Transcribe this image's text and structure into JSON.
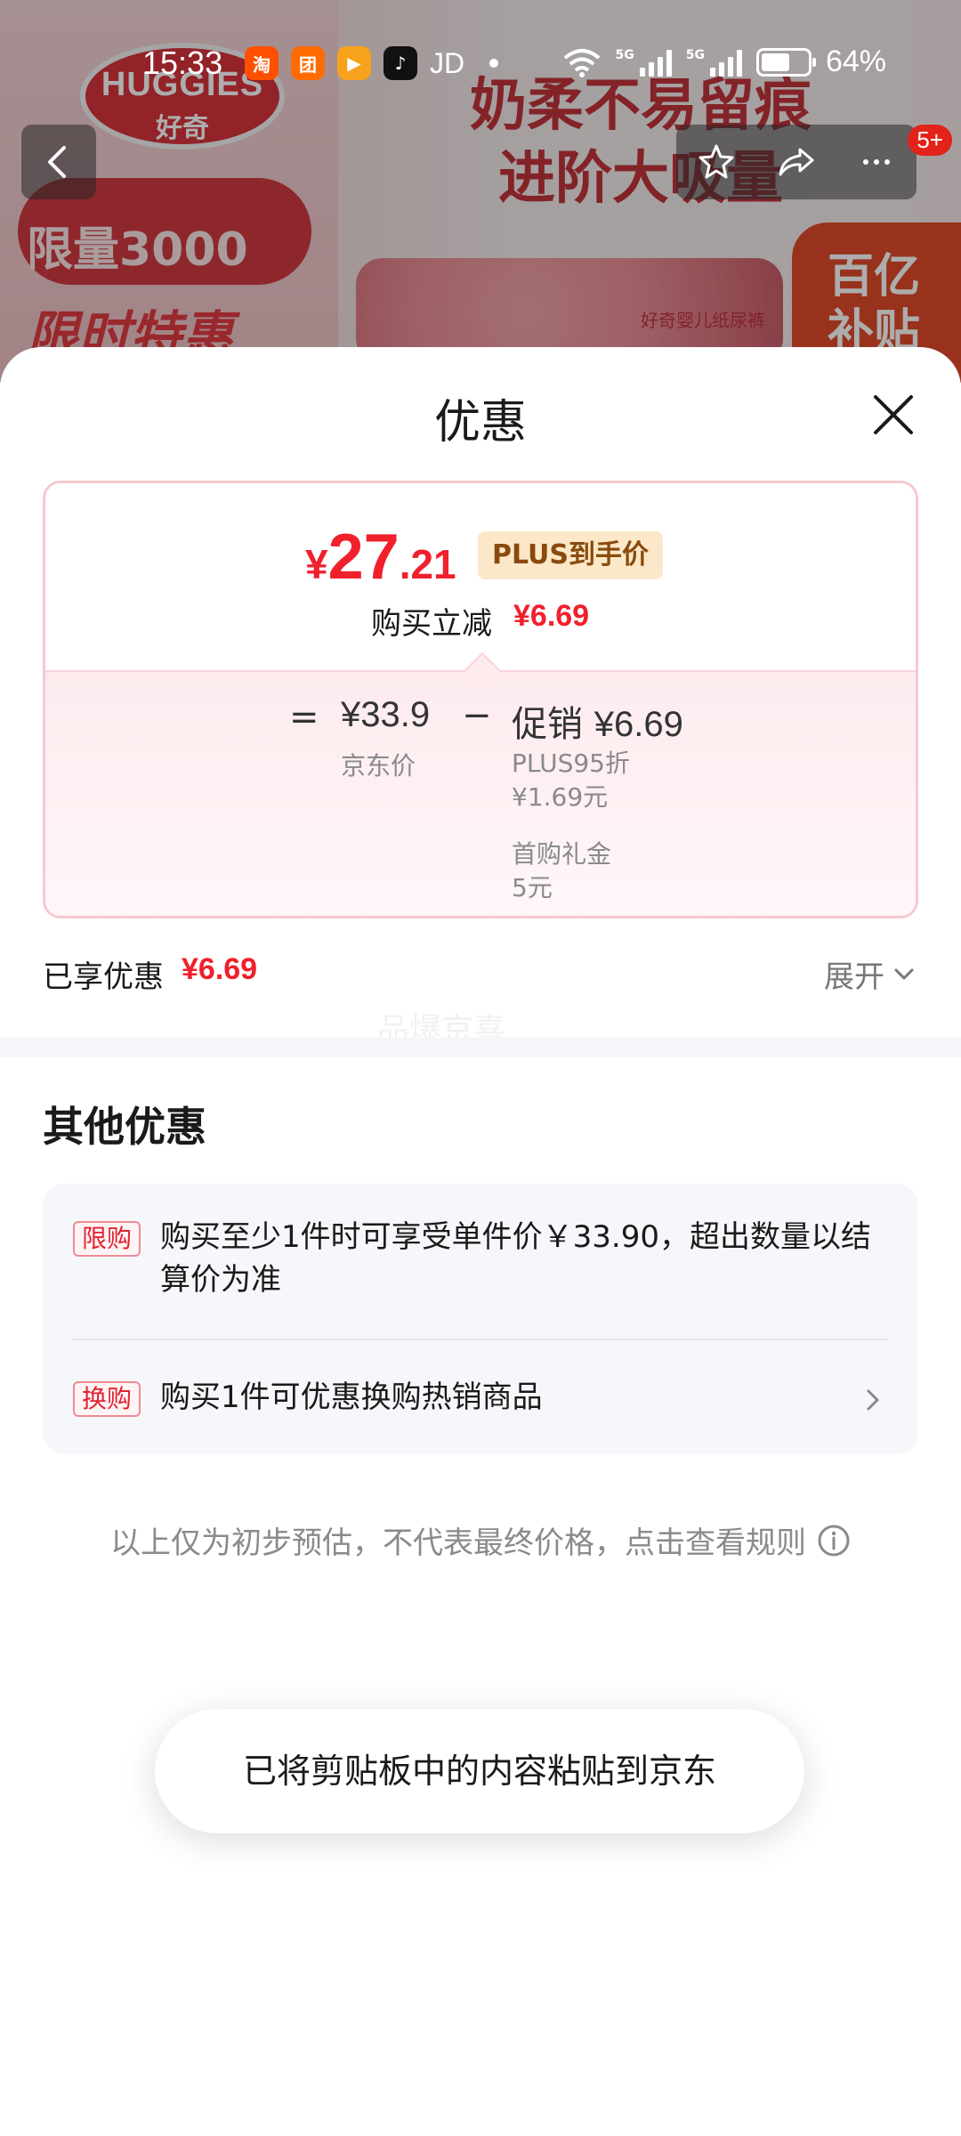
{
  "status_bar": {
    "time": "15:33",
    "app_icons": [
      {
        "name": "taobao-icon",
        "glyph": "淘",
        "color": "#ff5000"
      },
      {
        "name": "meituan-icon",
        "glyph": "团",
        "color": "#ff6b00"
      },
      {
        "name": "video-app-icon",
        "glyph": "▶",
        "color": "#f6a21c"
      },
      {
        "name": "tiktok-icon",
        "glyph": "♪",
        "color": "#111111"
      }
    ],
    "carrier_text": "JD",
    "network_1": "5G",
    "network_2": "5G",
    "battery_percent": "64%"
  },
  "banner": {
    "brand_line1": "HUGGIES",
    "brand_line2": "好奇",
    "limited": "限量3000",
    "timed": "限时特惠",
    "slogan_line1": "奶柔不易留痕",
    "slogan_line2": "进阶大吸量",
    "pack_label": "好奇婴儿纸尿裤",
    "subsidy_line1": "百亿",
    "subsidy_line2": "补贴",
    "cart_badge": "5+"
  },
  "sheet": {
    "title": "优惠",
    "price": {
      "currency": "¥",
      "integer": "27",
      "decimal": ".21",
      "tag": "PLUS到手价",
      "instant_label": "购买立减",
      "instant_value": "¥6.69"
    },
    "breakdown": {
      "equals": "=",
      "jd_price": "¥33.9",
      "jd_label": "京东价",
      "minus": "−",
      "promo_label": "促销",
      "promo_value": "¥6.69",
      "details": [
        {
          "name": "PLUS95折",
          "value": "¥1.69元"
        },
        {
          "name": "首购礼金",
          "value": "5元"
        }
      ]
    },
    "enjoyed_label": "已享优惠",
    "enjoyed_value": "¥6.69",
    "expand_label": "展开",
    "watermark": "品爆京喜",
    "other_title": "其他优惠",
    "other_items": [
      {
        "tag": "限购",
        "text": "购买至少1件时可享受单件价￥33.90，超出数量以结算价为准"
      },
      {
        "tag": "换购",
        "text": "购买1件可优惠换购热销商品"
      }
    ],
    "disclaimer": "以上仅为初步预估，不代表最终价格，点击查看规则"
  },
  "toast": "已将剪贴板中的内容粘贴到京东",
  "colors": {
    "accent_red": "#f0202c",
    "plus_tag_bg": "#fce8c8",
    "plus_tag_text": "#8a4a0d"
  }
}
